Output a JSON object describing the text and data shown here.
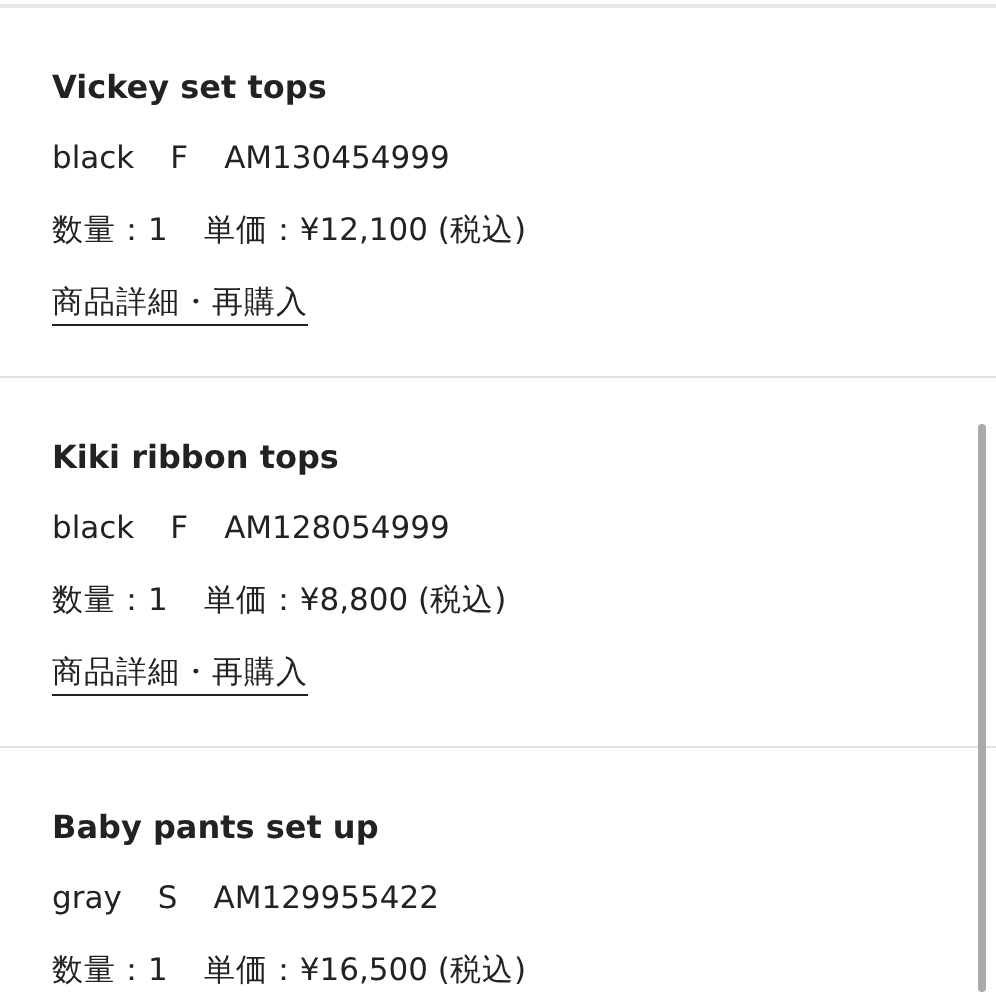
{
  "orders": [
    {
      "name": "Vickey set tops",
      "variant": "black",
      "size": "F",
      "code": "AM130454999",
      "quantity": "数量：1",
      "price": "単価：¥12,100 (税込)",
      "link": "商品詳細・再購入"
    },
    {
      "name": "Kiki ribbon tops",
      "variant": "black",
      "size": "F",
      "code": "AM128054999",
      "quantity": "数量：1",
      "price": "単価：¥8,800 (税込)",
      "link": "商品詳細・再購入"
    },
    {
      "name": "Baby pants set up",
      "variant": "gray",
      "size": "S",
      "code": "AM129955422",
      "quantity": "数量：1",
      "price": "単価：¥16,500 (税込)"
    }
  ]
}
